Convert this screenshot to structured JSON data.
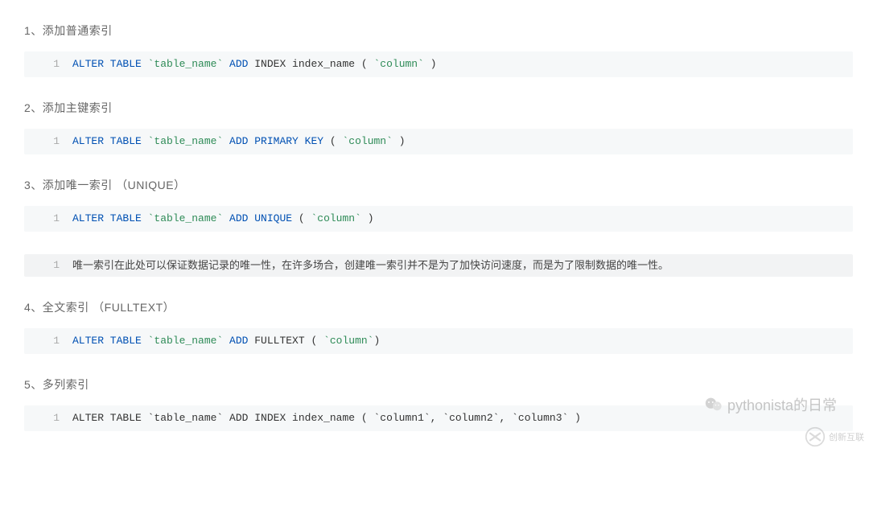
{
  "sections": {
    "s1": {
      "heading": "1、添加普通索引"
    },
    "s2": {
      "heading": "2、添加主键索引"
    },
    "s3": {
      "heading": "3、添加唯一索引 （UNIQUE）"
    },
    "s4": {
      "heading": "4、全文索引 （FULLTEXT）"
    },
    "s5": {
      "heading": "5、多列索引"
    }
  },
  "code": {
    "ln": "1",
    "c1": {
      "p1": "ALTER TABLE",
      "p2": " `table_name` ",
      "p3": "ADD",
      "p4": " INDEX index_name ( ",
      "p5": "`column`",
      "p6": " )"
    },
    "c2": {
      "p1": "ALTER TABLE",
      "p2": " `table_name` ",
      "p3": "ADD PRIMARY KEY",
      "p4": " ( ",
      "p5": "`column`",
      "p6": " )"
    },
    "c3": {
      "p1": "ALTER TABLE",
      "p2": " `table_name` ",
      "p3": "ADD UNIQUE",
      "p4": " ( ",
      "p5": "`column`",
      "p6": " )"
    },
    "c4": {
      "p1": "ALTER TABLE",
      "p2": " `table_name` ",
      "p3": "ADD",
      "p4": " FULLTEXT ( ",
      "p5": "`column`",
      "p6": ")"
    },
    "c5": {
      "full": "ALTER TABLE `table_name` ADD INDEX index_name ( `column1`, `column2`, `column3` )"
    }
  },
  "note": {
    "text": "唯一索引在此处可以保证数据记录的唯一性，在许多场合，创建唯一索引并不是为了加快访问速度，而是为了限制数据的唯一性。"
  },
  "watermark": {
    "text": "pythonista的日常"
  },
  "corner": {
    "text": "创新互联"
  }
}
